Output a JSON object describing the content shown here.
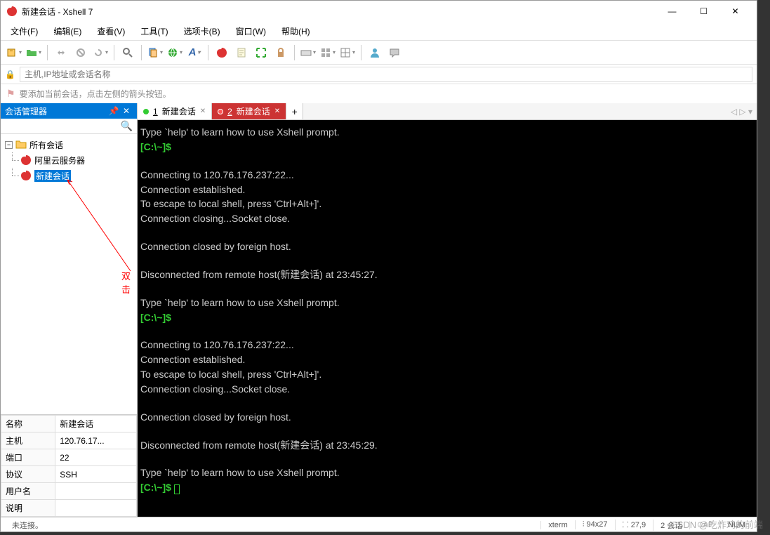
{
  "titlebar": {
    "title": "新建会话 - Xshell 7"
  },
  "menu": {
    "file": "文件(F)",
    "edit": "编辑(E)",
    "view": "查看(V)",
    "tools": "工具(T)",
    "tabs": "选项卡(B)",
    "window": "窗口(W)",
    "help": "帮助(H)"
  },
  "addressbar": {
    "placeholder": "主机,IP地址或会话名称"
  },
  "bookmark": {
    "hint": "要添加当前会话，点击左侧的箭头按钮。"
  },
  "sidebar": {
    "title": "会话管理器",
    "root": "所有会话",
    "items": [
      "阿里云服务器",
      "新建会话"
    ],
    "annotation": "双击"
  },
  "props": {
    "rows": [
      {
        "k": "名称",
        "v": "新建会话"
      },
      {
        "k": "主机",
        "v": "120.76.17..."
      },
      {
        "k": "端口",
        "v": "22"
      },
      {
        "k": "协议",
        "v": "SSH"
      },
      {
        "k": "用户名",
        "v": ""
      },
      {
        "k": "说明",
        "v": ""
      }
    ]
  },
  "tabs": {
    "t1": {
      "num": "1",
      "label": "新建会话"
    },
    "t2": {
      "num": "2",
      "label": "新建会话"
    }
  },
  "terminal": {
    "l1": "Type `help' to learn how to use Xshell prompt.",
    "p1": "[C:\\~]$",
    "l2": "Connecting to 120.76.176.237:22...",
    "l3": "Connection established.",
    "l4": "To escape to local shell, press 'Ctrl+Alt+]'.",
    "l5": "Connection closing...Socket close.",
    "l6": "Connection closed by foreign host.",
    "l7": "Disconnected from remote host(新建会话) at 23:45:27.",
    "l8": "Type `help' to learn how to use Xshell prompt.",
    "p2": "[C:\\~]$",
    "l9": "Connecting to 120.76.176.237:22...",
    "l10": "Connection established.",
    "l11": "To escape to local shell, press 'Ctrl+Alt+]'.",
    "l12": "Connection closing...Socket close.",
    "l13": "Connection closed by foreign host.",
    "l14": "Disconnected from remote host(新建会话) at 23:45:29.",
    "l15": "Type `help' to learn how to use Xshell prompt.",
    "p3": "[C:\\~]$ "
  },
  "status": {
    "left": "未连接。",
    "term": "xterm",
    "size": "⫶ 94x27",
    "pos": "⸬ 27,9",
    "sess": "2 会话",
    "caps": "CAP",
    "num": "NUM"
  },
  "watermark": "CSDN @吃炸鸡的前端"
}
